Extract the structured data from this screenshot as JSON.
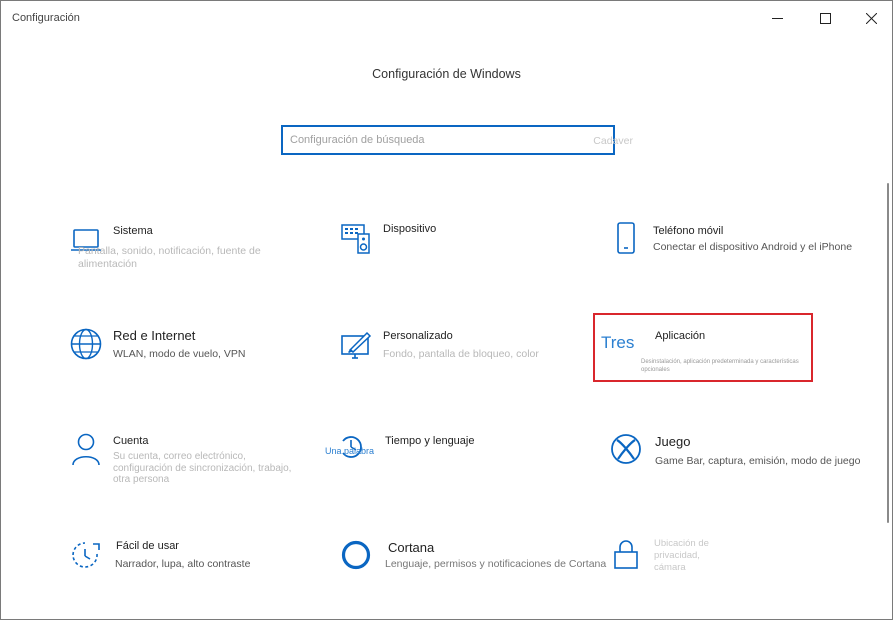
{
  "window": {
    "title": "Configuración",
    "heading": "Configuración de Windows",
    "controls": {
      "minimize": "minimize-icon",
      "maximize": "maximize-icon",
      "close": "close-icon"
    }
  },
  "search": {
    "placeholder": "Configuración de búsqueda",
    "hint": "Cadaver"
  },
  "tiles": {
    "sistema": {
      "title": "Sistema",
      "desc": "Pantalla, sonido, notificación, fuente de alimentación",
      "icon": "laptop-icon"
    },
    "dispositivo": {
      "title": "Dispositivo",
      "desc": "",
      "icon": "keyboard-speaker-icon"
    },
    "telefono": {
      "title": "Teléfono móvil",
      "desc": "Conectar el dispositivo Android y el iPhone",
      "icon": "phone-icon"
    },
    "red": {
      "title": "Red e Internet",
      "desc": "WLAN, modo de vuelo, VPN",
      "icon": "globe-icon"
    },
    "personalizado": {
      "title": "Personalizado",
      "desc": "Fondo, pantalla de bloqueo, color",
      "icon": "paint-monitor-icon"
    },
    "aplicacion": {
      "title": "Aplicación",
      "desc": "Desinstalación, aplicación predeterminada y características opcionales",
      "overlay": "Tres"
    },
    "cuenta": {
      "title": "Cuenta",
      "desc": "Su cuenta, correo electrónico, configuración de sincronización, trabajo, otra persona",
      "icon": "person-icon"
    },
    "tiempo": {
      "title": "Tiempo y lenguaje",
      "desc": "",
      "icon": "clock-icon",
      "overlay": "Una palabra"
    },
    "juego": {
      "title": "Juego",
      "desc": "Game Bar, captura, emisión, modo de juego",
      "icon": "xbox-icon"
    },
    "facil": {
      "title": "Fácil de usar",
      "desc": "Narrador, lupa, alto contraste",
      "icon": "accessibility-timer-icon"
    },
    "cortana": {
      "title": "Cortana",
      "desc": "Lenguaje, permisos y notificaciones de Cortana",
      "icon": "cortana-ring-icon"
    },
    "privacidad": {
      "title": "Ubicación de privacidad, cámara",
      "desc": "",
      "icon": "lock-icon"
    }
  },
  "colors": {
    "accent": "#0a66c2",
    "highlight": "#d9262c"
  }
}
